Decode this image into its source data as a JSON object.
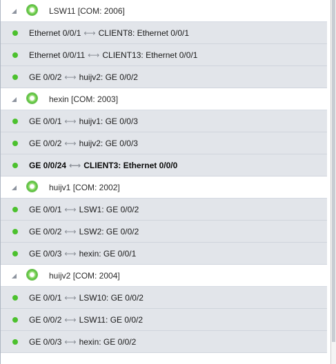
{
  "groups": [
    {
      "label": "LSW11 [COM: 2006]",
      "links": [
        {
          "local": "Ethernet 0/0/1",
          "remote": "CLIENT8: Ethernet 0/0/1",
          "selected": false
        },
        {
          "local": "Ethernet 0/0/11",
          "remote": "CLIENT13: Ethernet 0/0/1",
          "selected": false
        },
        {
          "local": "GE 0/0/2",
          "remote": "huijv2: GE 0/0/2",
          "selected": false
        }
      ]
    },
    {
      "label": "hexin [COM: 2003]",
      "links": [
        {
          "local": "GE 0/0/1",
          "remote": "huijv1: GE 0/0/3",
          "selected": false
        },
        {
          "local": "GE 0/0/2",
          "remote": "huijv2: GE 0/0/3",
          "selected": false
        },
        {
          "local": "GE 0/0/24",
          "remote": "CLIENT3: Ethernet 0/0/0",
          "selected": true
        }
      ]
    },
    {
      "label": "huijv1 [COM: 2002]",
      "links": [
        {
          "local": "GE 0/0/1",
          "remote": "LSW1: GE 0/0/2",
          "selected": false
        },
        {
          "local": "GE 0/0/2",
          "remote": "LSW2: GE 0/0/2",
          "selected": false
        },
        {
          "local": "GE 0/0/3",
          "remote": "hexin: GE 0/0/1",
          "selected": false
        }
      ]
    },
    {
      "label": "huijv2 [COM: 2004]",
      "links": [
        {
          "local": "GE 0/0/1",
          "remote": "LSW10: GE 0/0/2",
          "selected": false
        },
        {
          "local": "GE 0/0/2",
          "remote": "LSW11: GE 0/0/2",
          "selected": false
        },
        {
          "local": "GE 0/0/3",
          "remote": "hexin: GE 0/0/2",
          "selected": false
        }
      ]
    }
  ],
  "link_arrow_glyph": "⟷",
  "colors": {
    "status_online": "#4cc12e",
    "row_background": "#e2e5ea",
    "header_background": "#ffffff"
  },
  "icons": {
    "group_expander": "expander-triangle-icon",
    "group_status": "device-online-icon",
    "link_status": "link-up-dot-icon",
    "link_connector": "bidirectional-arrow-icon"
  }
}
